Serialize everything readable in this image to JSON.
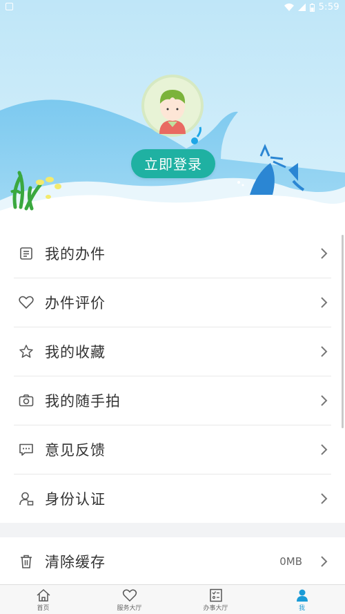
{
  "status_bar": {
    "time": "5:59"
  },
  "header": {
    "login_label": "立即登录"
  },
  "menu": [
    {
      "id": "my-tasks",
      "label": "我的办件",
      "icon": "document-list-icon"
    },
    {
      "id": "task-review",
      "label": "办件评价",
      "icon": "heart-icon"
    },
    {
      "id": "my-favorites",
      "label": "我的收藏",
      "icon": "star-icon"
    },
    {
      "id": "my-photos",
      "label": "我的随手拍",
      "icon": "camera-icon"
    },
    {
      "id": "feedback",
      "label": "意见反馈",
      "icon": "chat-bubble-icon"
    },
    {
      "id": "identity-verification",
      "label": "身份认证",
      "icon": "user-id-icon"
    }
  ],
  "cache": {
    "label": "清除缓存",
    "value": "0MB",
    "icon": "trash-icon"
  },
  "tabbar": [
    {
      "label": "首页",
      "icon": "home-icon",
      "active": false
    },
    {
      "label": "服务大厅",
      "icon": "heart-icon",
      "active": false
    },
    {
      "label": "办事大厅",
      "icon": "checklist-icon",
      "active": false
    },
    {
      "label": "我",
      "icon": "person-icon",
      "active": true
    }
  ],
  "colors": {
    "accent": "#1fb1a2",
    "tab_active": "#1a9bd7"
  }
}
